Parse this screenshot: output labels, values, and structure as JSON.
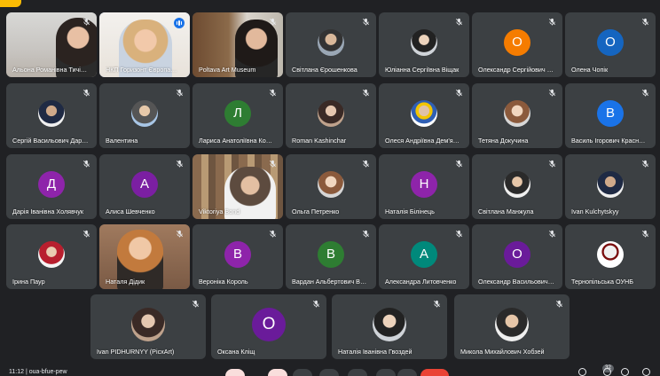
{
  "meeting": {
    "clock": "11:12",
    "code": "oua-bfue-pew",
    "participant_count": "32"
  },
  "colors": {
    "tile_bg": "#3c4043",
    "page_bg": "#202124",
    "speaking_outline": "#8ab4f8"
  },
  "tiles": [
    {
      "name": "Альона Романівна Тичі…",
      "kind": "video",
      "feed": "feed1",
      "muted": true
    },
    {
      "name": "НКП Горизонт Європа…",
      "kind": "video",
      "feed": "feed2",
      "muted": false,
      "speaking": true
    },
    {
      "name": "Poltava Art Museum",
      "kind": "video",
      "feed": "feed3",
      "muted": true
    },
    {
      "name": "Світлана Єрошенкова",
      "kind": "photo",
      "photo": "b",
      "muted": true
    },
    {
      "name": "Юліанна Сергіївна Віщак",
      "kind": "photo",
      "photo": "h",
      "muted": true
    },
    {
      "name": "Олександр Сергійович …",
      "kind": "letter",
      "letter": "О",
      "color": "#f57c00",
      "muted": true
    },
    {
      "name": "Олена Чопік",
      "kind": "letter",
      "letter": "О",
      "color": "#1565c0",
      "muted": true
    },
    {
      "name": "Сергій Васильович Дар…",
      "kind": "photo",
      "photo": "d",
      "muted": true
    },
    {
      "name": "Валентина",
      "kind": "photo",
      "photo": "g",
      "muted": true
    },
    {
      "name": "Лариса Анатоліївна Ко…",
      "kind": "letter",
      "letter": "Л",
      "color": "#2e7d32",
      "muted": true
    },
    {
      "name": "Roman Kashinchar",
      "kind": "photo",
      "photo": "f",
      "muted": true
    },
    {
      "name": "Олеся Андріївна Дем'я…",
      "kind": "photo",
      "photo": "e",
      "muted": true
    },
    {
      "name": "Тетяна Докучина",
      "kind": "photo",
      "photo": "c",
      "muted": true
    },
    {
      "name": "Василь Ігорович Красн…",
      "kind": "letter",
      "letter": "В",
      "color": "#1a73e8",
      "muted": true
    },
    {
      "name": "Дарія Іванівна Холявчук",
      "kind": "letter",
      "letter": "Д",
      "color": "#8e24aa",
      "muted": true
    },
    {
      "name": "Алиса Шевченко",
      "kind": "letter",
      "letter": "А",
      "color": "#7b1fa2",
      "muted": true
    },
    {
      "name": "Viktoriya Bond",
      "kind": "video",
      "feed": "feed4",
      "muted": true
    },
    {
      "name": "Ольга Петренко",
      "kind": "photo",
      "photo": "c",
      "muted": true
    },
    {
      "name": "Наталія Білінець",
      "kind": "letter",
      "letter": "Н",
      "color": "#8e24aa",
      "muted": true
    },
    {
      "name": "Світлана Манжула",
      "kind": "photo",
      "photo": "k",
      "muted": true
    },
    {
      "name": "Ivan Kulchytskyy",
      "kind": "photo",
      "photo": "d",
      "muted": true
    },
    {
      "name": "Ірина Паур",
      "kind": "photo",
      "photo": "i",
      "muted": true
    },
    {
      "name": "Наталя Дідик",
      "kind": "video",
      "feed": "feed5",
      "muted": true
    },
    {
      "name": "Вероніка Король",
      "kind": "letter",
      "letter": "В",
      "color": "#8e24aa",
      "muted": true
    },
    {
      "name": "Вардан Альбертович В…",
      "kind": "letter",
      "letter": "В",
      "color": "#2e7d32",
      "muted": true
    },
    {
      "name": "Александра Литовченко",
      "kind": "letter",
      "letter": "А",
      "color": "#00897b",
      "muted": true
    },
    {
      "name": "Олександр Васильович…",
      "kind": "letter",
      "letter": "О",
      "color": "#6a1b9a",
      "muted": true
    },
    {
      "name": "Тернопільська ОУНБ",
      "kind": "photo",
      "photo": "j",
      "muted": true
    }
  ],
  "bottom_tiles": [
    {
      "name": "Ivan PIDHURNYY (PicxArt)",
      "kind": "photo",
      "photo": "f",
      "muted": true
    },
    {
      "name": "Оксана Кліщ",
      "kind": "letter",
      "letter": "О",
      "color": "#6a1b9a",
      "muted": true
    },
    {
      "name": "Наталія Іванівна Гвоздей",
      "kind": "photo",
      "photo": "h",
      "muted": true
    },
    {
      "name": "Микола Михайлович Хобзей",
      "kind": "photo",
      "photo": "k",
      "muted": true
    }
  ],
  "icons": {
    "mic_off": "mic-off-icon",
    "speaking": "speaking-indicator-icon"
  }
}
